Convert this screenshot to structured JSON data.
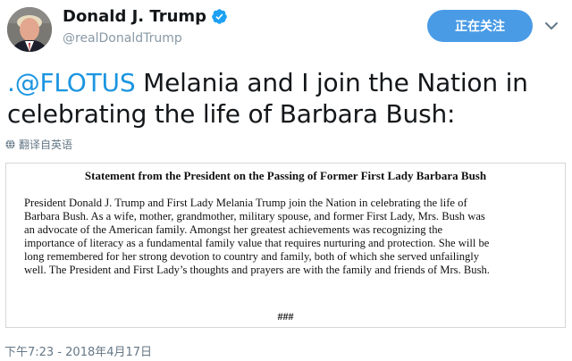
{
  "author": {
    "display_name": "Donald J. Trump",
    "handle": "@realDonaldTrump",
    "verified_icon": "verified-badge-icon",
    "avatar_icon": "profile-photo"
  },
  "follow_button": {
    "label": "正在关注"
  },
  "menu": {
    "icon": "chevron-down-icon"
  },
  "tweet": {
    "mention": ".@FLOTUS",
    "text_after_mention": " Melania and I join the Nation in celebrating the life of Barbara Bush:",
    "translate_label": "翻译自英语",
    "timestamp": "下午7:23 - 2018年4月17日"
  },
  "statement": {
    "title": "Statement from the President on the Passing of Former First Lady Barbara Bush",
    "lines": [
      "President Donald J. Trump and First Lady Melania Trump join the Nation in celebrating the life of",
      "Barbara Bush. As a wife, mother, grandmother, military spouse, and former First Lady, Mrs. Bush was",
      "an advocate of the American family. Amongst her greatest achievements was recognizing the",
      "importance of literacy as a fundamental family value that requires nurturing and protection. She will be",
      "long remembered for her strong devotion to country and family, both of which she served unfailingly",
      "well. The President and First Lady’s thoughts and prayers are with the family and friends of Mrs. Bush."
    ],
    "footer": "###"
  },
  "colors": {
    "follow_button_bg": "#4a9be6",
    "mention": "#1b95e0",
    "verified": "#1da1f2",
    "muted_text": "#8899a6"
  }
}
